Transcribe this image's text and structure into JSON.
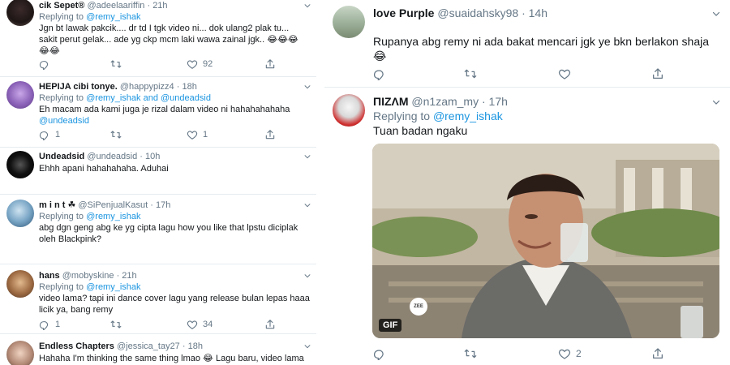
{
  "left_column": {
    "tweets": [
      {
        "name": "cik Sepet®",
        "handle": "@adeelaariffin",
        "time": "21h",
        "replying_to_label": "Replying to",
        "replying_to_handle": "@remy_ishak",
        "text_lines": [
          "Jgn bt lawak pakcik.... dr td I tgk video ni... dok ulang2 plak tu...",
          "sakit perut gelak...  ade yg ckp mcm laki wawa zainal jgk.. 😂😂😂",
          "😂😂"
        ],
        "actions": {
          "reply_count": "",
          "retweet_count": "",
          "like_count": "92"
        }
      },
      {
        "name": "HEPIJA cibi tonye.",
        "handle": "@happypizz4",
        "time": "18h",
        "replying_to_label": "Replying to",
        "replying_to_handle": "@remy_ishak",
        "replying_to_and": "and",
        "replying_to_handle2": "@undeadsid",
        "text_lines": [
          "Eh macam ada kami juga je rizal dalam video ni hahahahahaha"
        ],
        "text_mention": "@undeadsid",
        "actions": {
          "reply_count": "1",
          "retweet_count": "",
          "like_count": "1"
        }
      },
      {
        "name": "Undeadsid",
        "handle": "@undeadsid",
        "time": "10h",
        "text_lines": [
          "Ehhh apani hahahahaha. Aduhai"
        ]
      },
      {
        "name": "m i n t ☘",
        "handle": "@SiPenjualKasut",
        "time": "17h",
        "replying_to_label": "Replying to",
        "replying_to_handle": "@remy_ishak",
        "text_lines": [
          "abg dgn geng abg ke yg cipta lagu how you like that lpstu diciplak",
          "oleh Blackpink?"
        ]
      },
      {
        "name": "hans",
        "handle": "@mobyskine",
        "time": "21h",
        "replying_to_label": "Replying to",
        "replying_to_handle": "@remy_ishak",
        "text_lines": [
          "video lama? tapi ini dance cover lagu yang release bulan lepas haaa",
          "licik ya, bang remy"
        ],
        "actions": {
          "reply_count": "1",
          "retweet_count": "",
          "like_count": "34"
        }
      },
      {
        "name": "Endless Chapters",
        "handle": "@jessica_tay27",
        "time": "18h",
        "text_lines": [
          "Hahaha I'm thinking the same thing lmao 😂 Lagu baru, video lama"
        ]
      }
    ]
  },
  "right_column": {
    "tweets": [
      {
        "name": "love Purple",
        "handle": "@suaidahsky98",
        "time": "14h",
        "text_lines": [
          "Rupanya abg remy ni ada bakat mencari jgk ye bkn berlakon shaja",
          "😂"
        ],
        "actions": {
          "reply_count": "",
          "retweet_count": "",
          "like_count": ""
        }
      },
      {
        "name": "ПIZΛM",
        "handle": "@n1zam_my",
        "time": "17h",
        "replying_to_label": "Replying to",
        "replying_to_handle": "@remy_ishak",
        "text_lines": [
          "Tuan badan ngaku"
        ],
        "media_badge": "GIF",
        "media_watermark": "ZEE",
        "actions": {
          "reply_count": "",
          "retweet_count": "",
          "like_count": "2"
        }
      }
    ]
  },
  "colors": {
    "link": "#1b95e0",
    "muted": "#657786",
    "text": "#14171a",
    "divider": "#e6ecf0"
  },
  "icons": [
    "reply-icon",
    "retweet-icon",
    "like-icon",
    "share-icon",
    "chevron-down-icon"
  ]
}
